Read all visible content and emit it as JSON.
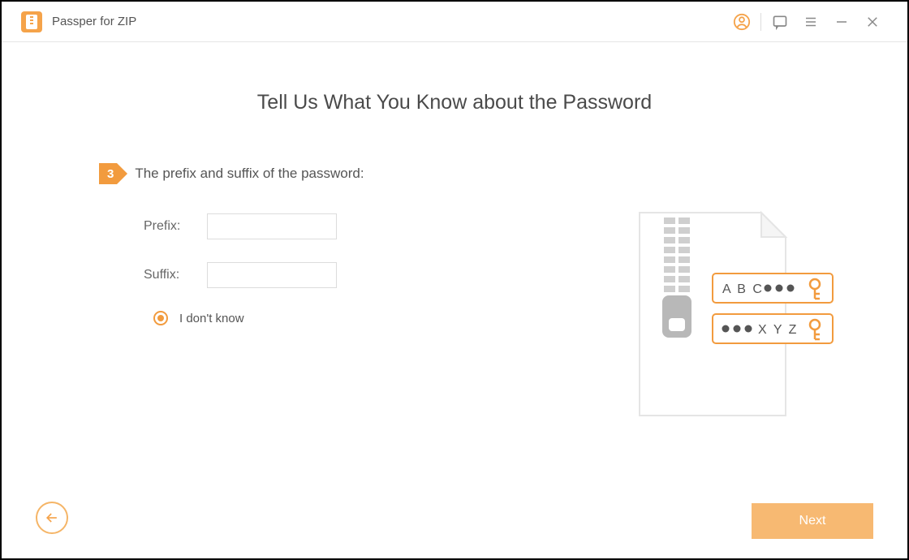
{
  "app": {
    "title": "Passper for ZIP"
  },
  "page": {
    "heading": "Tell Us What You Know about the Password",
    "step_number": "3",
    "step_text": "The prefix and suffix of the password:",
    "prefix_label": "Prefix:",
    "suffix_label": "Suffix:",
    "prefix_value": "",
    "suffix_value": "",
    "dont_know_label": "I don't know",
    "illustration_text1": "A B C",
    "illustration_text2": "X Y Z"
  },
  "nav": {
    "next_label": "Next"
  }
}
